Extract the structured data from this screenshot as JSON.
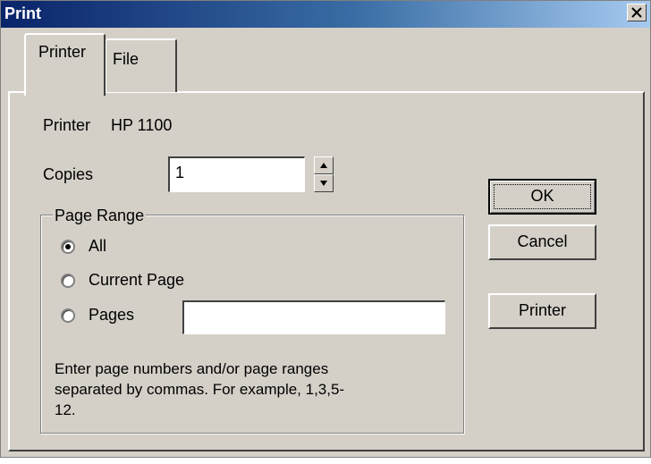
{
  "window": {
    "title": "Print",
    "close_icon": "close-icon"
  },
  "tabs": [
    {
      "label": "Printer",
      "active": true
    },
    {
      "label": "File",
      "active": false
    }
  ],
  "printer": {
    "label": "Printer",
    "name": "HP 1100"
  },
  "copies": {
    "label": "Copies",
    "value": "1"
  },
  "page_range": {
    "legend": "Page Range",
    "options": [
      {
        "label": "All",
        "selected": true
      },
      {
        "label": "Current Page",
        "selected": false
      },
      {
        "label": "Pages",
        "selected": false
      }
    ],
    "pages_value": "",
    "help": "Enter page numbers and/or page ranges separated by commas.  For example, 1,3,5-12."
  },
  "buttons": {
    "ok": "OK",
    "cancel": "Cancel",
    "printer": "Printer"
  },
  "colors": {
    "face": "#d4d0c8",
    "title_start": "#0a246a",
    "title_end": "#a6caf0"
  }
}
